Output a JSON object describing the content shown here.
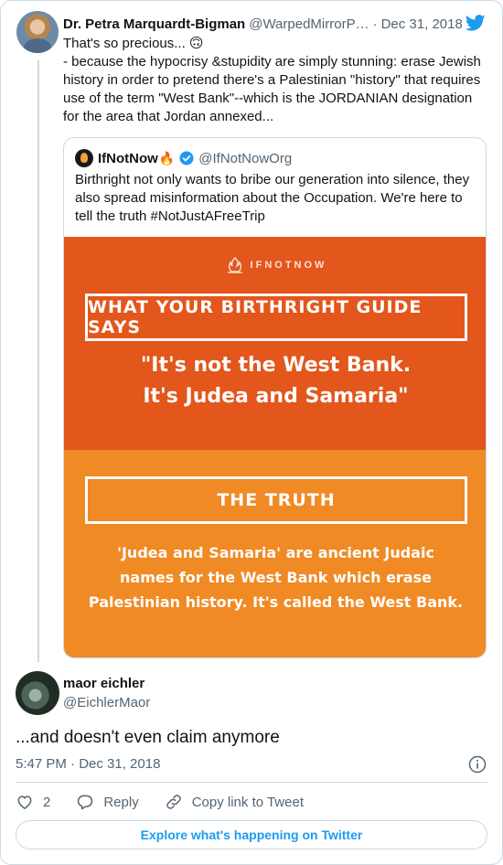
{
  "parent_tweet": {
    "author_name": "Dr. Petra Marquardt-Bigman",
    "author_handle": "@WarpedMirrorP…",
    "separator": "·",
    "date": "Dec 31, 2018",
    "line1": "That's so precious... 🙃",
    "line2": "- because the hypocrisy &stupidity are simply stunning: erase Jewish history in order to pretend there's a Palestinian \"history\" that requires use of the term \"West Bank\"--which is the JORDANIAN designation for the area that Jordan annexed...",
    "icons": {
      "brand": "twitter-bird-icon",
      "color": "#1d9bf0"
    }
  },
  "quoted_tweet": {
    "author_name": "IfNotNow",
    "name_emoji": "🔥",
    "author_handle": "@IfNotNowOrg",
    "text": "Birthright not only wants to bribe our generation into silence, they also spread misinformation about the Occupation. We're here to tell the truth #NotJustAFreeTrip",
    "image": {
      "brand": "IFNOTNOW",
      "heading1": "WHAT YOUR BIRTHRIGHT GUIDE SAYS",
      "claim_line1": "\"It's not the West Bank.",
      "claim_line2": "It's Judea and Samaria\"",
      "heading2": "THE TRUTH",
      "truth_line1": "'Judea and Samaria' are ancient Judaic",
      "truth_line2": "names for the West Bank which erase",
      "truth_line3": "Palestinian history. It's called the West Bank.",
      "top_color": "#e3561c",
      "bottom_color": "#f08a24"
    }
  },
  "main_tweet": {
    "author_name": "maor eichler",
    "author_handle": "@EichlerMaor",
    "text": "...and doesn't even claim anymore",
    "timestamp": "5:47 PM · Dec 31, 2018"
  },
  "actions": {
    "like_count": "2",
    "reply_label": "Reply",
    "copy_label": "Copy link to Tweet"
  },
  "footer": {
    "explore_label": "Explore what's happening on Twitter"
  }
}
